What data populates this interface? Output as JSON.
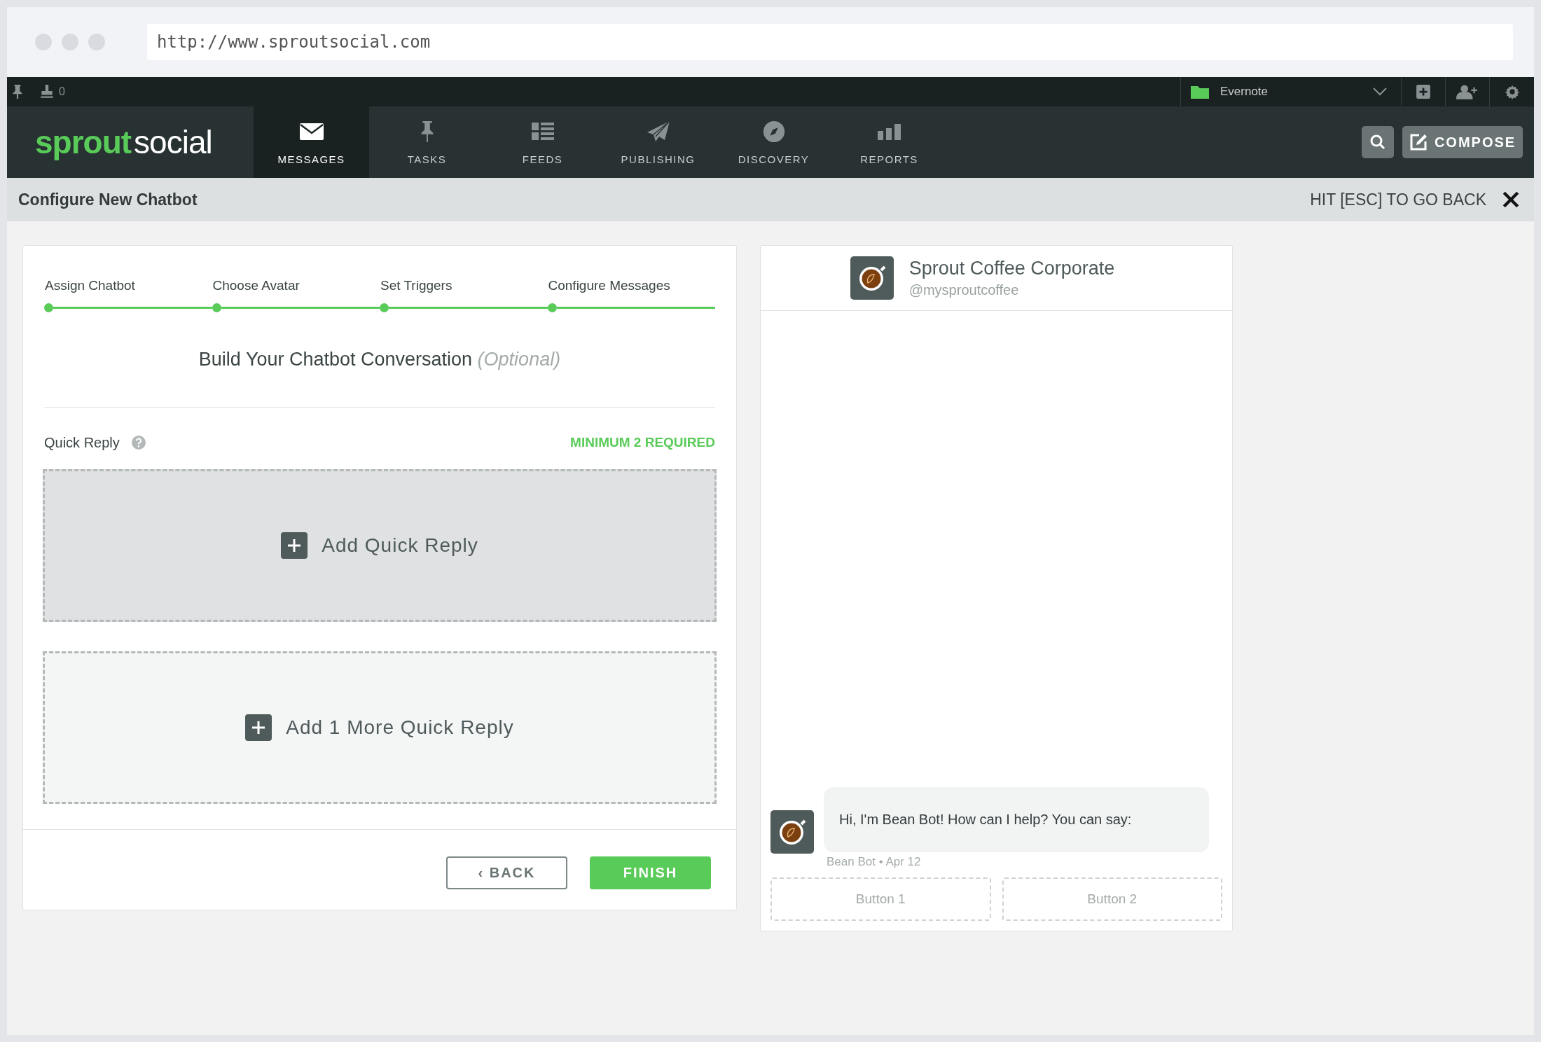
{
  "browser": {
    "url": "http://www.sproutsocial.com"
  },
  "topbar": {
    "tasks_count": "0",
    "account": "Evernote"
  },
  "logo": {
    "bold": "sprout",
    "light": "social"
  },
  "nav": [
    {
      "label": "MESSAGES",
      "selected": true
    },
    {
      "label": "TASKS",
      "selected": false
    },
    {
      "label": "FEEDS",
      "selected": false
    },
    {
      "label": "PUBLISHING",
      "selected": false
    },
    {
      "label": "DISCOVERY",
      "selected": false
    },
    {
      "label": "REPORTS",
      "selected": false
    }
  ],
  "compose_button": "COMPOSE",
  "header": {
    "title": "Configure New Chatbot",
    "hint": "HIT [ESC] TO GO BACK"
  },
  "steps": [
    {
      "label": "Assign Chatbot",
      "completed": true
    },
    {
      "label": "Choose Avatar",
      "completed": true
    },
    {
      "label": "Set Triggers",
      "completed": true
    },
    {
      "label": "Configure Messages",
      "completed": true
    }
  ],
  "section_title": "Build Your Chatbot Conversation",
  "section_note": "(Optional)",
  "quick_reply": {
    "label": "Quick Reply",
    "requirement": "MINIMUM 2 REQUIRED"
  },
  "reply_slots": [
    {
      "label": "Add Quick Reply",
      "hovered": true
    },
    {
      "label": "Add 1 More Quick Reply",
      "hovered": false
    }
  ],
  "buttons": {
    "back": "‹ BACK",
    "finish": "FINISH"
  },
  "preview": {
    "name": "Sprout Coffee Corporate",
    "handle": "@mysproutcoffee",
    "message": "Hi, I'm Bean Bot! How can I help? You can say:",
    "meta": "Bean Bot • Apr 12",
    "reply_buttons": [
      "Button 1",
      "Button 2"
    ]
  }
}
